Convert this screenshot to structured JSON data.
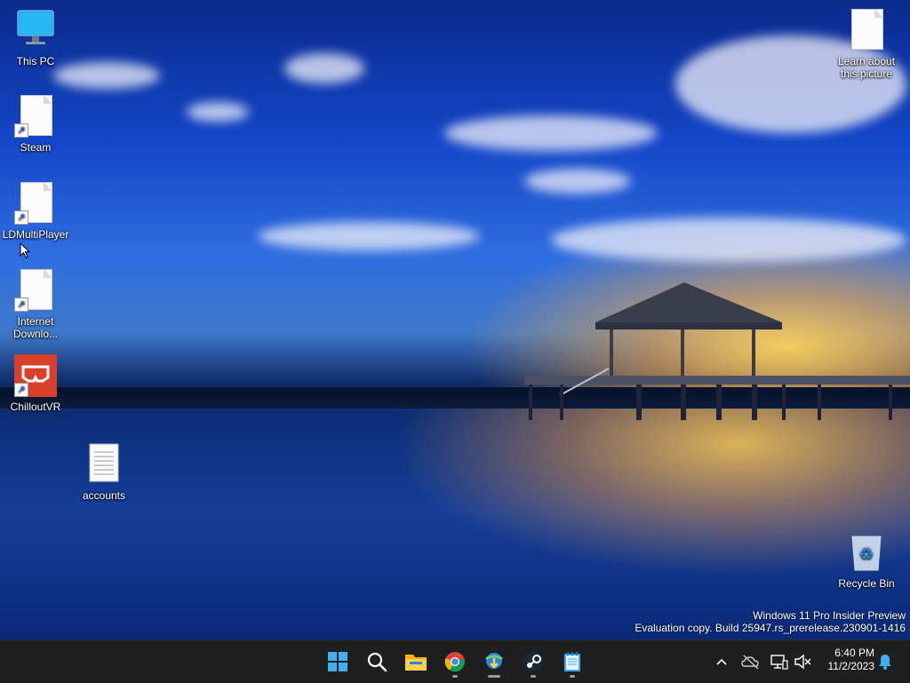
{
  "desktop": {
    "icons": [
      {
        "label": "This PC"
      },
      {
        "label": "Steam"
      },
      {
        "label": "LDMultiPlayer"
      },
      {
        "label": "Internet Downlo..."
      },
      {
        "label": "ChilloutVR"
      },
      {
        "label": "accounts"
      },
      {
        "label": "Learn about this picture"
      },
      {
        "label": "Recycle Bin"
      }
    ],
    "watermark": {
      "line1": "Windows 11 Pro Insider Preview",
      "line2": "Evaluation copy. Build 25947.rs_prerelease.230901-1416"
    }
  },
  "taskbar": {
    "pinned": [
      {
        "icon": "windows-start-icon"
      },
      {
        "icon": "search-icon"
      },
      {
        "icon": "file-explorer-icon"
      },
      {
        "icon": "chrome-icon"
      },
      {
        "icon": "internet-download-manager-icon"
      },
      {
        "icon": "steam-icon"
      },
      {
        "icon": "notepad-icon"
      }
    ],
    "tray": {
      "time": "6:40 PM",
      "date": "11/2/2023"
    }
  },
  "colors": {
    "taskbar_bg": "#1f1f1f",
    "accent": "#0078d4",
    "chillout_red": "#d9402b"
  }
}
